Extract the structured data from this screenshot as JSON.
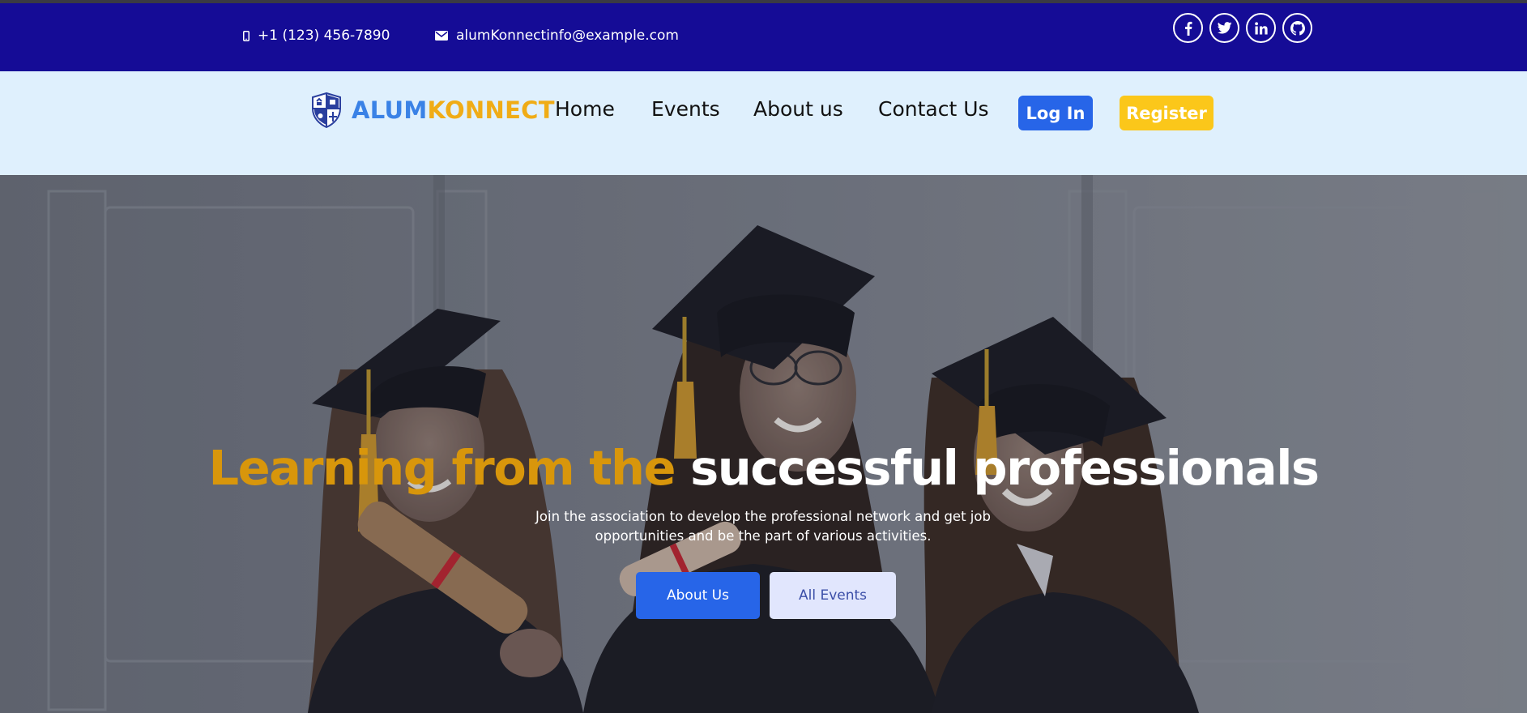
{
  "topbar": {
    "phone": "+1 (123) 456-7890",
    "email": "alumKonnectinfo@example.com",
    "socials": [
      "facebook-icon",
      "twitter-icon",
      "linkedin-icon",
      "github-icon"
    ]
  },
  "nav": {
    "brand_part1": "ALUM",
    "brand_part2": "KONNECT",
    "items": [
      "Home",
      "Events",
      "About us",
      "Contact Us"
    ],
    "login": "Log In",
    "register": "Register"
  },
  "hero": {
    "headline_gold": "Learning from the",
    "headline_white": "successful professionals",
    "subtext_line1": "Join the association to develop the professional network and get job",
    "subtext_line2": "opportunities and be the part of various activities.",
    "btn_about": "About Us",
    "btn_events": "All Events"
  },
  "colors": {
    "topbar": "#150c96",
    "navbar": "#dff0fd",
    "brand_blue": "#3a82e6",
    "brand_gold": "#f0ac16",
    "primary": "#2765e8",
    "register": "#fbc71a",
    "headline_gold": "#d8960b"
  }
}
